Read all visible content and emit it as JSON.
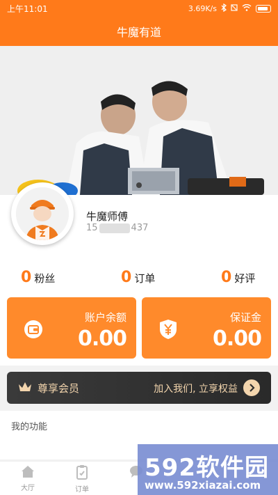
{
  "status_bar": {
    "time": "上午11:01",
    "speed": "3.69K/s"
  },
  "header": {
    "title": "牛魔有道"
  },
  "profile": {
    "name": "牛魔师傅",
    "phone_prefix": "15",
    "phone_suffix": "437"
  },
  "stats": [
    {
      "value": "0",
      "label": "粉丝"
    },
    {
      "value": "0",
      "label": "订单"
    },
    {
      "value": "0",
      "label": "好评"
    }
  ],
  "cards": {
    "balance": {
      "title": "账户余额",
      "value": "0.00",
      "icon": "wallet-icon"
    },
    "deposit": {
      "title": "保证金",
      "value": "0.00",
      "icon": "yen-shield-icon"
    }
  },
  "vip": {
    "label": "尊享会员",
    "cta": "加入我们, 立享权益"
  },
  "features": {
    "title": "我的功能"
  },
  "tabs": [
    {
      "label": "大厅",
      "icon": "home-icon"
    },
    {
      "label": "订单",
      "icon": "clipboard-icon"
    },
    {
      "label": "",
      "icon": "message-icon"
    }
  ],
  "watermark": {
    "logo": "592软件园",
    "url": "www.592xiazai.com"
  },
  "colors": {
    "accent": "#ff7a1a",
    "card": "#ff8a2b",
    "vip_bg": "#2e2e2e",
    "vip_text": "#f3d5ad"
  }
}
